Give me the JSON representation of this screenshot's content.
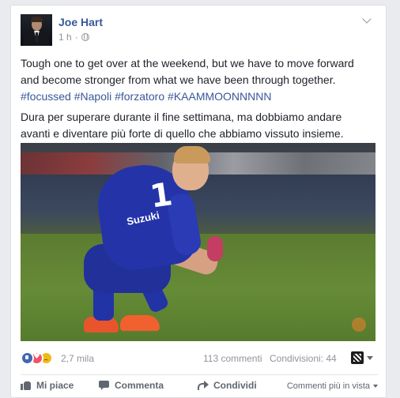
{
  "post": {
    "author": "Joe Hart",
    "time": "1 h",
    "text_en_lines": [
      "Tough one to get over at the weekend, but we have to move forward",
      "and become stronger from what we have been through together."
    ],
    "hashtags": [
      "#focussed",
      "#Napoli",
      "#forzatoro",
      "#KAAMMOONNNNN"
    ],
    "text_it_lines": [
      "Dura per superare durante il fine settimana, ma dobbiamo andare",
      "avanti e diventare più forte di quello che abbiamo vissuto insieme."
    ],
    "photo": {
      "shirt_number": "1",
      "sponsor": "Suzuki"
    }
  },
  "stats": {
    "reactions": "2,7 mila",
    "reaction_icons": [
      "like-icon",
      "love-icon",
      "sad-icon"
    ],
    "comments": "113 commenti",
    "shares": "Condivisioni: 44"
  },
  "actions": {
    "like": "Mi piace",
    "comment": "Commenta",
    "share": "Condividi",
    "sort": "Commenti più in vista"
  },
  "colors": {
    "link": "#365899",
    "like_blue": "#4267b2",
    "love_red": "#f25268",
    "sad_yellow": "#f0ba15"
  }
}
